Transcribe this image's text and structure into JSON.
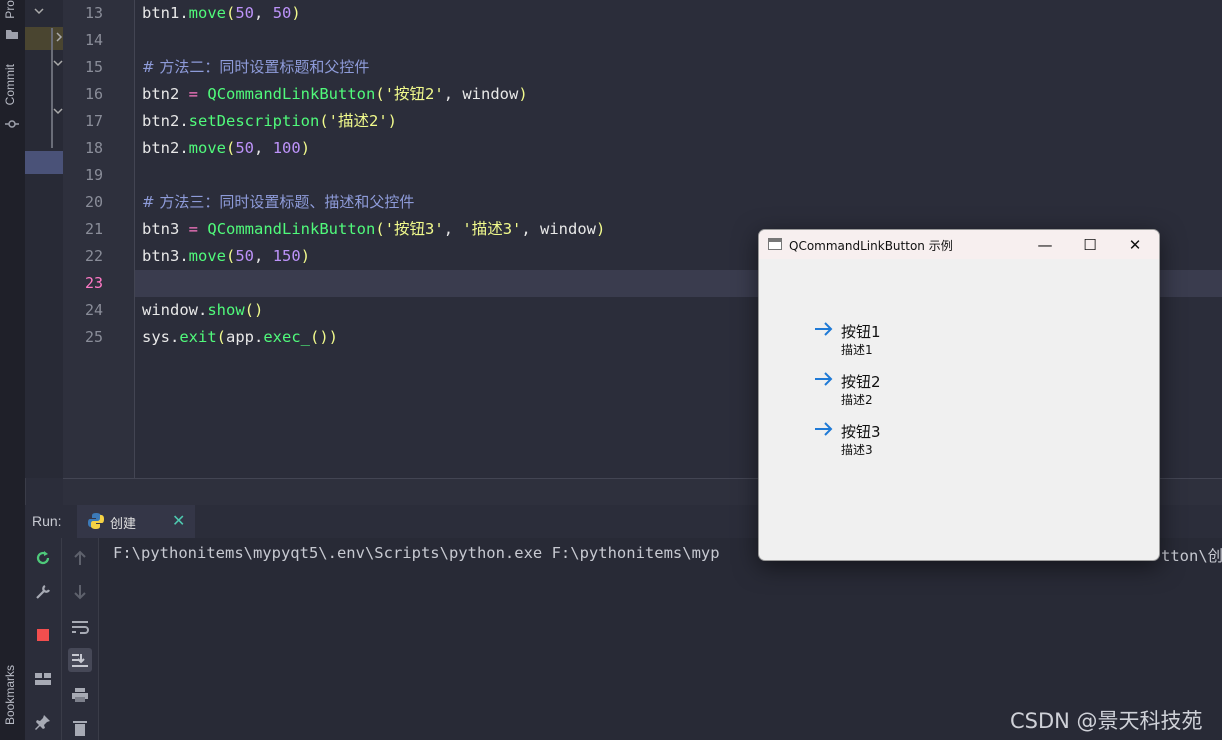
{
  "left_strip": {
    "project_label": "Pro",
    "commit_label": "Commit",
    "bookmarks_label": "Bookmarks"
  },
  "editor": {
    "line_numbers": [
      "13",
      "14",
      "15",
      "16",
      "17",
      "18",
      "19",
      "20",
      "21",
      "22",
      "23",
      "24",
      "25"
    ],
    "current_line": "23",
    "lines": [
      {
        "parts": [
          [
            "txt",
            "btn1."
          ],
          [
            "fn",
            "move"
          ],
          [
            "paren",
            "("
          ],
          [
            "num",
            "50"
          ],
          [
            "txt",
            ", "
          ],
          [
            "num",
            "50"
          ],
          [
            "paren",
            ")"
          ]
        ]
      },
      {
        "parts": []
      },
      {
        "parts": [
          [
            "cmt",
            "# 方法二：同时设置标题和父控件"
          ]
        ]
      },
      {
        "parts": [
          [
            "txt",
            "btn2 "
          ],
          [
            "op",
            "="
          ],
          [
            "txt",
            " "
          ],
          [
            "fn",
            "QCommandLinkButton"
          ],
          [
            "paren",
            "("
          ],
          [
            "str",
            "'按钮2'"
          ],
          [
            "txt",
            ", window"
          ],
          [
            "paren",
            ")"
          ]
        ]
      },
      {
        "parts": [
          [
            "txt",
            "btn2."
          ],
          [
            "fn",
            "setDescription"
          ],
          [
            "paren",
            "("
          ],
          [
            "str",
            "'描述2'"
          ],
          [
            "paren",
            ")"
          ]
        ]
      },
      {
        "parts": [
          [
            "txt",
            "btn2."
          ],
          [
            "fn",
            "move"
          ],
          [
            "paren",
            "("
          ],
          [
            "num",
            "50"
          ],
          [
            "txt",
            ", "
          ],
          [
            "num",
            "100"
          ],
          [
            "paren",
            ")"
          ]
        ]
      },
      {
        "parts": []
      },
      {
        "parts": [
          [
            "cmt",
            "# 方法三：同时设置标题、描述和父控件"
          ]
        ]
      },
      {
        "parts": [
          [
            "txt",
            "btn3 "
          ],
          [
            "op",
            "="
          ],
          [
            "txt",
            " "
          ],
          [
            "fn",
            "QCommandLinkButton"
          ],
          [
            "paren",
            "("
          ],
          [
            "str",
            "'按钮3'"
          ],
          [
            "txt",
            ", "
          ],
          [
            "str",
            "'描述3'"
          ],
          [
            "txt",
            ", window"
          ],
          [
            "paren",
            ")"
          ]
        ]
      },
      {
        "parts": [
          [
            "txt",
            "btn3."
          ],
          [
            "fn",
            "move"
          ],
          [
            "paren",
            "("
          ],
          [
            "num",
            "50"
          ],
          [
            "txt",
            ", "
          ],
          [
            "num",
            "150"
          ],
          [
            "paren",
            ")"
          ]
        ]
      },
      {
        "parts": []
      },
      {
        "parts": [
          [
            "txt",
            "window."
          ],
          [
            "fn",
            "show"
          ],
          [
            "paren",
            "()"
          ]
        ]
      },
      {
        "parts": [
          [
            "txt",
            "sys."
          ],
          [
            "fn",
            "exit"
          ],
          [
            "paren",
            "("
          ],
          [
            "txt",
            "app."
          ],
          [
            "fn",
            "exec_"
          ],
          [
            "paren",
            "())"
          ]
        ]
      }
    ]
  },
  "run_panel": {
    "label": "Run:",
    "tab_label": "创建",
    "tab_close": "✕",
    "console_text": "F:\\pythonitems\\mypyqt5\\.env\\Scripts\\python.exe F:\\pythonitems\\myp",
    "console_text_tail": "tton\\创建"
  },
  "qt_window": {
    "title": "QCommandLinkButton 示例",
    "minimize": "—",
    "maximize": "☐",
    "close": "✕",
    "buttons": [
      {
        "title": "按钮1",
        "description": "描述1"
      },
      {
        "title": "按钮2",
        "description": "描述2"
      },
      {
        "title": "按钮3",
        "description": "描述3"
      }
    ],
    "arrow_color": "#1f7ad6"
  },
  "watermark": "CSDN @景天科技苑",
  "colors": {
    "accent": "#6b7cff",
    "run_green": "#4ec9b0",
    "stop_red": "#f24e4e"
  }
}
